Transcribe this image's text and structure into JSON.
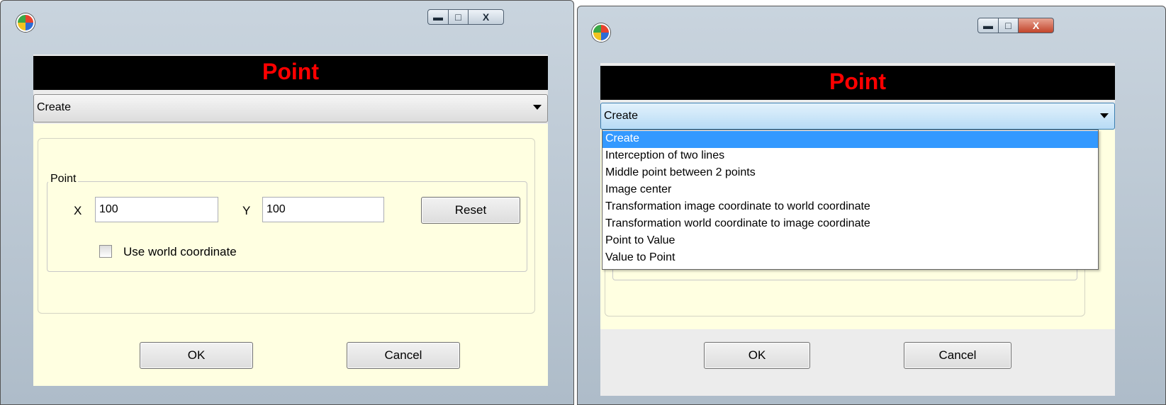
{
  "window1": {
    "header_title": "Point",
    "operation": {
      "selected": "Create"
    },
    "group": {
      "label": "Point"
    },
    "x": {
      "label": "X",
      "value": "100"
    },
    "y": {
      "label": "Y",
      "value": "100"
    },
    "reset_label": "Reset",
    "use_world": {
      "label": "Use world coordinate",
      "checked": false
    },
    "ok_label": "OK",
    "cancel_label": "Cancel",
    "caption_buttons": {
      "minimize": "minimize-icon",
      "maximize": "maximize-icon",
      "close": "close-icon"
    }
  },
  "window2": {
    "header_title": "Point",
    "operation": {
      "selected": "Create",
      "options": [
        "Create",
        "Interception of two lines",
        "Middle point between 2 points",
        "Image center",
        "Transformation image coordinate to world coordinate",
        "Transformation world  coordinate to image  coordinate",
        "Point to Value",
        "Value to Point"
      ]
    },
    "ok_label": "OK",
    "cancel_label": "Cancel"
  },
  "colors": {
    "header_bg": "#000000",
    "header_text": "#ff0000",
    "panel_bg": "#ffffe1",
    "selected_option": "#3399ff"
  }
}
